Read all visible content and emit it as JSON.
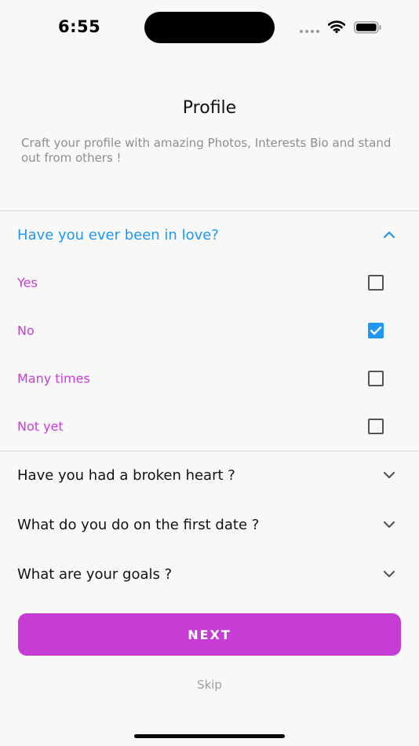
{
  "status_bar": {
    "time": "6:55"
  },
  "header": {
    "title": "Profile",
    "subtitle": "Craft your profile with amazing Photos, Interests Bio and stand out from others !"
  },
  "questions": [
    {
      "text": "Have you ever been in love?",
      "expanded": true,
      "options": [
        {
          "label": "Yes",
          "checked": false
        },
        {
          "label": "No",
          "checked": true
        },
        {
          "label": "Many times",
          "checked": false
        },
        {
          "label": "Not yet",
          "checked": false
        }
      ]
    },
    {
      "text": "Have you had a broken heart ?",
      "expanded": false
    },
    {
      "text": "What do you do on the first date ?",
      "expanded": false
    },
    {
      "text": "What are your goals ?",
      "expanded": false
    }
  ],
  "actions": {
    "next_label": "NEXT",
    "skip_label": "Skip"
  },
  "colors": {
    "accent": "#c63dd6",
    "selected_blue": "#2196f3",
    "subtitle_gray": "#8e8e8e"
  }
}
